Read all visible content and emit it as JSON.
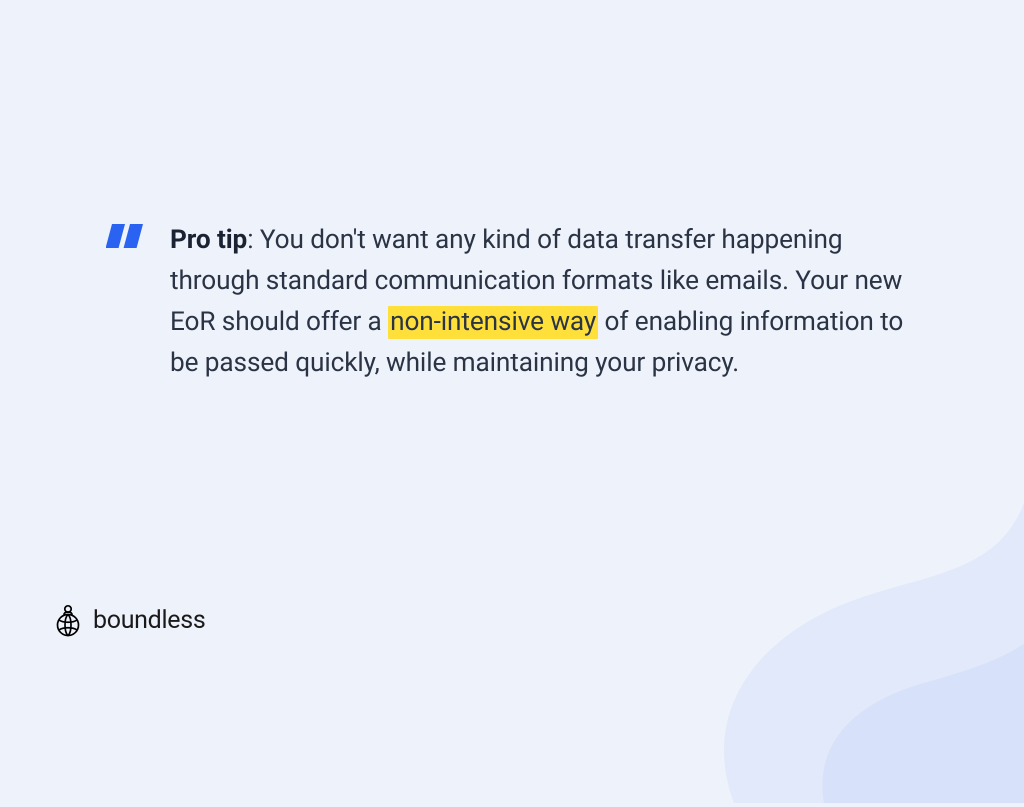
{
  "quote": {
    "label": "Pro tip",
    "text_before_highlight": ": You don't want any kind of data transfer happening through standard communication formats like emails. Your new EoR should offer a ",
    "highlight": "non-intensive way",
    "text_after_highlight": " of enabling information to be passed quickly, while maintaining your privacy."
  },
  "brand": {
    "name": "boundless"
  },
  "colors": {
    "accent_blue": "#2a63f1",
    "highlight_yellow": "#ffe03a",
    "bg": "#eef2fb",
    "bg_decoration": "#dfe8fa",
    "text": "#2b3445"
  }
}
